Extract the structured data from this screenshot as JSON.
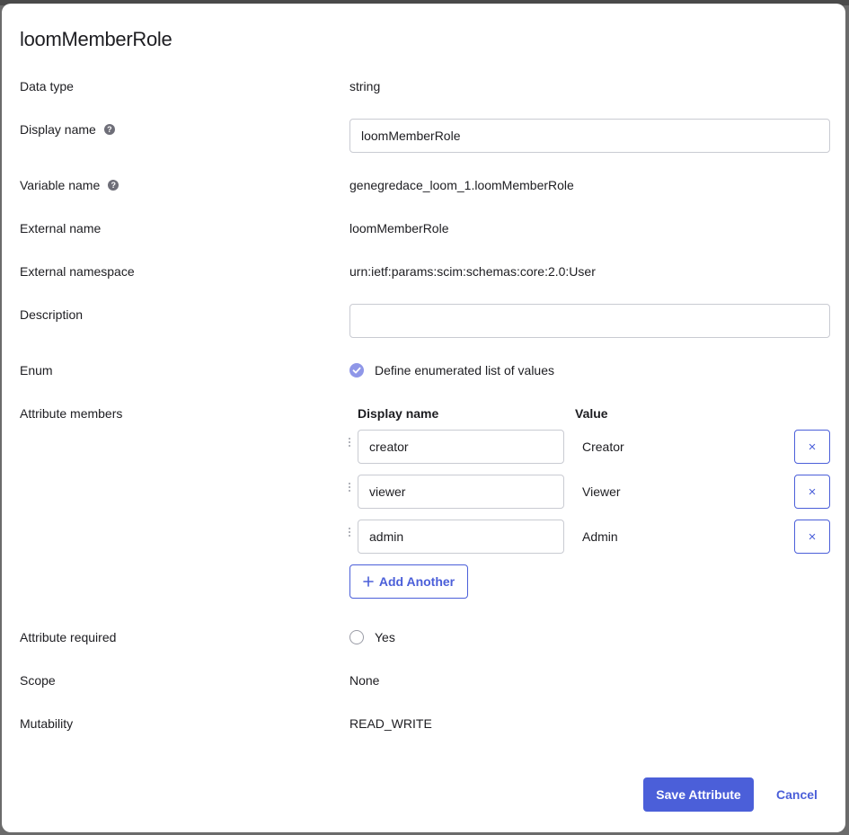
{
  "dialog": {
    "title": "loomMemberRole"
  },
  "fields": {
    "data_type": {
      "label": "Data type",
      "value": "string"
    },
    "display_name": {
      "label": "Display name",
      "value": "loomMemberRole"
    },
    "variable_name": {
      "label": "Variable name",
      "value": "genegredace_loom_1.loomMemberRole"
    },
    "external_name": {
      "label": "External name",
      "value": "loomMemberRole"
    },
    "external_namespace": {
      "label": "External namespace",
      "value": "urn:ietf:params:scim:schemas:core:2.0:User"
    },
    "description": {
      "label": "Description",
      "value": ""
    },
    "enum": {
      "label": "Enum",
      "checkbox_label": "Define enumerated list of values",
      "checked": true
    },
    "attribute_members": {
      "label": "Attribute members",
      "col_display_name": "Display name",
      "col_value": "Value",
      "rows": [
        {
          "display_name": "creator",
          "value": "Creator"
        },
        {
          "display_name": "viewer",
          "value": "Viewer"
        },
        {
          "display_name": "admin",
          "value": "Admin"
        }
      ],
      "add_label": "Add Another",
      "remove_glyph": "×"
    },
    "attribute_required": {
      "label": "Attribute required",
      "checkbox_label": "Yes",
      "checked": false
    },
    "scope": {
      "label": "Scope",
      "value": "None"
    },
    "mutability": {
      "label": "Mutability",
      "value": "READ_WRITE"
    }
  },
  "footer": {
    "save_label": "Save Attribute",
    "cancel_label": "Cancel"
  },
  "icons": {
    "help": "help-icon",
    "check": "checkmark-icon",
    "drag": "drag-handle-icon",
    "close": "close-icon",
    "plus": "plus-icon"
  },
  "colors": {
    "accent": "#4b5fd9",
    "checkbox_checked": "#8f97e8",
    "border": "#c9cbd2",
    "text": "#1d1d21"
  }
}
